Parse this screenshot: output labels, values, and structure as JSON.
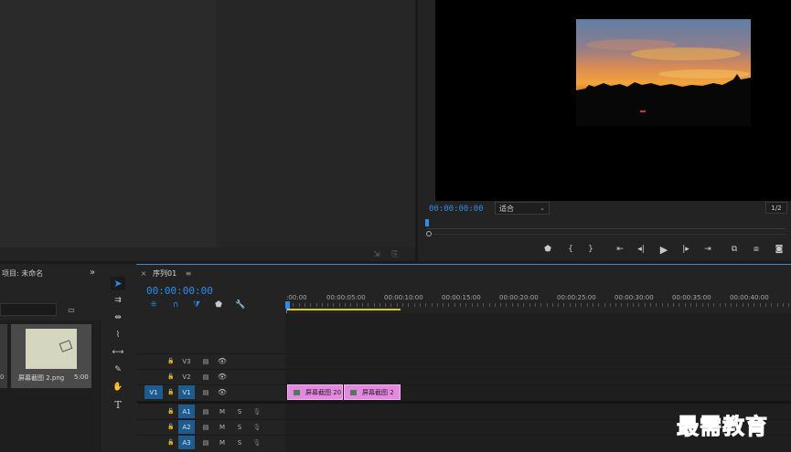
{
  "source_panel": {},
  "program_monitor": {
    "timecode": "00:00:00:00",
    "fit_label": "适合",
    "resolution": "1/2"
  },
  "project_panel": {
    "title": "项目: 未命名",
    "item_name": "屏幕截图 2.png",
    "item_duration": "5:00",
    "left_cut_num": "0"
  },
  "timeline": {
    "tab_label": "序列01",
    "timecode": "00:00:00:00",
    "ruler": [
      ":00:00",
      "00:00:05:00",
      "00:00:10:00",
      "00:00:15:00",
      "00:00:20:00",
      "00:00:25:00",
      "00:00:30:00",
      "00:00:35:00",
      "00:00:40:00"
    ],
    "video_tracks": [
      {
        "name": "V3",
        "source": ""
      },
      {
        "name": "V2",
        "source": ""
      },
      {
        "name": "V1",
        "source": "V1"
      }
    ],
    "audio_tracks": [
      {
        "name": "A1",
        "mute": "M",
        "solo": "S"
      },
      {
        "name": "A2",
        "mute": "M",
        "solo": "S"
      },
      {
        "name": "A3",
        "mute": "M",
        "solo": "S"
      }
    ],
    "clips": [
      {
        "label": "屏幕截图 20"
      },
      {
        "label": "屏幕截图 2"
      }
    ]
  },
  "watermark": "最需教育",
  "colors": {
    "accent": "#2d8ceb",
    "clip": "#e38ae0",
    "track_active": "#1f5c8d",
    "work_area": "#d7c63a"
  }
}
